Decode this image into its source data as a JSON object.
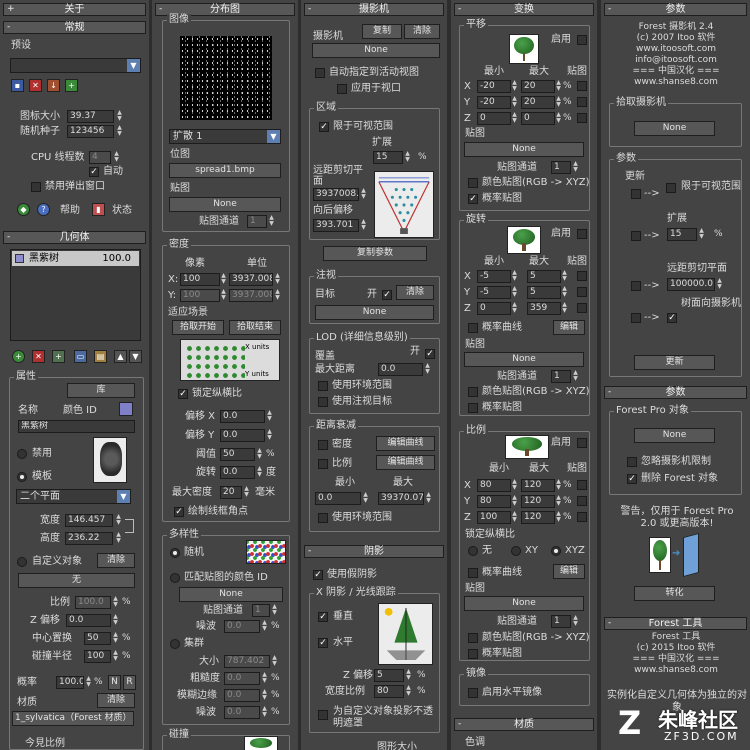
{
  "c1": {
    "about": "关于",
    "general": "常规",
    "preset": "预设",
    "icon_size": "图标大小",
    "icon_size_v": "39.37",
    "seed": "随机种子",
    "seed_v": "123456",
    "cpu": "CPU 线程数",
    "cpu_v": "4",
    "auto": "自动",
    "disable_popup": "禁用弹出窗口",
    "help": "帮助",
    "status": "状态",
    "geometry": "几何体",
    "geo_item": "黑紫树",
    "geo_item_v": "100.0",
    "props": "属性",
    "lib": "库",
    "name": "名称",
    "color_id": "颜色 ID",
    "name_v": "黑紫树",
    "disable": "禁用",
    "template": "模板",
    "plane": "二个平面",
    "width": "宽度",
    "width_v": "146.457",
    "height": "高度",
    "height_v": "236.22",
    "custom_obj": "自定义对象",
    "clear": "清除",
    "none_btn": "无",
    "scale": "比例",
    "scale_v": "100.0",
    "zoff": "Z 偏移",
    "zoff_v": "0.0",
    "center_disp": "中心置换",
    "center_disp_v": "50",
    "collision": "碰撞半径",
    "collision_v": "100",
    "prob": "概率",
    "prob_v": "100.0",
    "n": "N",
    "r": "R",
    "material": "材质",
    "mat_clear": "清除",
    "mat_v": "1_sylvatica（Forest 材质）",
    "bottom": "今見比例"
  },
  "c2": {
    "dist": "分布图",
    "image": "图像",
    "spread": "扩散 1",
    "bitmap": "位图",
    "bitmap_v": "spread1.bmp",
    "map": "贴图",
    "none": "None",
    "map_ch": "贴图通道",
    "map_ch_v": "1",
    "density": "密度",
    "pixels": "像素",
    "units": "单位",
    "x_px": "100",
    "x_un": "3937.008",
    "y_px": "100",
    "y_un": "3937.008",
    "fit": "适应场景",
    "pick_start": "拾取开始",
    "pick_end": "拾取结束",
    "x_units": "X units",
    "y_units": "Y units",
    "lock": "锁定纵横比",
    "offx": "偏移 X",
    "offx_v": "0.0",
    "offy": "偏移 Y",
    "offy_v": "0.0",
    "threshold": "阈值",
    "threshold_v": "50",
    "rotation": "旋转",
    "rotation_v": "0.0",
    "deg": "度",
    "maxdens": "最大密度",
    "maxdens_v": "20",
    "mm": "毫米",
    "draw_bbox": "绘制线框角点",
    "diversity": "多样性",
    "random": "随机",
    "match_color": "匹配贴图的颜色 ID",
    "none2": "None",
    "map_ch2": "贴图通道",
    "map_ch2_v": "1",
    "noise": "噪波",
    "noise_v": "0.0",
    "cluster": "集群",
    "size": "大小",
    "size_v": "787.402",
    "roughness": "粗糙度",
    "roughness_v": "0.0",
    "blur_edge": "模糊边缘",
    "blur_edge_v": "0.0",
    "noise2": "噪波",
    "noise2_v": "0.0",
    "collision": "碰撞"
  },
  "c3": {
    "camera": "摄影机",
    "cam_lbl": "摄影机",
    "copy": "复制",
    "clear": "清除",
    "none": "None",
    "auto_assign": "自动指定到活动视图",
    "apply_viewport": "应用于视口",
    "area": "区域",
    "limit_visible": "限于可视范围",
    "expand": "扩展",
    "expand_v": "15",
    "far_clip": "远距剪切平面",
    "far_clip_v": "3937008.",
    "back_offset": "向后偏移",
    "back_offset_v": "393.701",
    "copy_params": "复制参数",
    "target_grp": "注视",
    "target": "目标",
    "on": "开",
    "clear2": "清除",
    "none2": "None",
    "lod": "LOD (详细信息级别)",
    "cover": "覆盖",
    "cover_on": "开",
    "max_dist": "最大距离",
    "max_dist_v": "0.0",
    "use_env": "使用环境范围",
    "use_target": "使用注视目标",
    "falloff": "距离衰减",
    "density": "密度",
    "edit_curve": "编辑曲线",
    "scale": "比例",
    "edit_curve2": "编辑曲线",
    "min": "最小",
    "max": "最大",
    "min_v": "0.0",
    "max_v": "39370.07",
    "use_env2": "使用环境范围",
    "shadow": "阴影",
    "use_fake": "使用假阴影",
    "xshadow": "X 阴影 / 光线跟踪",
    "vertical": "垂直",
    "horizontal": "水平",
    "zoff": "Z 偏移",
    "zoff_v": "5",
    "wscale": "宽度比例",
    "wscale_v": "80",
    "custom_shadow": "为自定义对象投影不透明遮罩",
    "bottom": "图形大小"
  },
  "c4": {
    "transform": "变换",
    "translate": "平移",
    "enable": "启用",
    "min": "最小",
    "max": "最大",
    "map": "贴图",
    "tx_min": "-20",
    "tx_max": "20",
    "ty_min": "-20",
    "ty_max": "20",
    "tz_min": "0",
    "tz_max": "0",
    "map_lbl": "贴图",
    "none": "None",
    "map_ch": "贴图通道",
    "map_ch_v": "1",
    "color_map": "颜色贴图(RGB -> XYZ)",
    "prob_map": "概率贴图",
    "rotate": "旋转",
    "enable2": "启用",
    "rx_min": "-5",
    "rx_max": "5",
    "ry_min": "-5",
    "ry_max": "5",
    "rz_min": "0",
    "rz_max": "359",
    "prob_curve": "概率曲线",
    "edit": "编辑",
    "map2": "贴图",
    "none2": "None",
    "map_ch2": "贴图通道",
    "map_ch2_v": "1",
    "color_map2": "颜色贴图(RGB -> XYZ)",
    "prob_map2": "概率贴图",
    "scale": "比例",
    "enable3": "启用",
    "sx_min": "80",
    "sx_max": "120",
    "sy_min": "80",
    "sy_max": "120",
    "sz_min": "100",
    "sz_max": "120",
    "lock_aspect": "锁定纵横比",
    "none_r": "无",
    "xy": "XY",
    "xyz": "XYZ",
    "prob_curve2": "概率曲线",
    "edit2": "编辑",
    "map3": "贴图",
    "none3": "None",
    "map_ch3": "贴图通道",
    "map_ch3_v": "1",
    "color_map3": "颜色贴图(RGB -> XYZ)",
    "prob_map3": "概率贴图",
    "mirror": "镜像",
    "mirror_h": "启用水平镜像",
    "material": "材质",
    "color_adj": "色调"
  },
  "c5": {
    "params": "参数",
    "l1": "Forest 摄影机 2.4",
    "l2": "(c) 2007 Itoo 软件",
    "l3": "www.itoosoft.com",
    "l4": "info@itoosoft.com",
    "l5": "=== 中国汉化 ===",
    "l6": "www.shanse8.com",
    "pick_cam": "拾取摄影机",
    "none": "None",
    "params2": "参数",
    "update": "更新",
    "limit_vis": "限于可视范围",
    "expand": "扩展",
    "expand_v": "15",
    "far_clip": "远距剪切平面",
    "far_clip_v": "100000.0",
    "tree_face": "树面向摄影机",
    "update_btn": "更新",
    "params3": "参数",
    "fpro": "Forest Pro 对象",
    "none2": "None",
    "ignore_cam": "忽略摄影机限制",
    "del_forest": "删除 Forest 对象",
    "warn": "警告，仅用于 Forest Pro 2.0 或更高版本!",
    "convert": "转化",
    "ftools": "Forest 工具",
    "t1": "Forest 工具",
    "t2": "(c) 2015 Itoo 软件",
    "t3": "=== 中国汉化 ===",
    "t4": "www.shanse8.com",
    "instance": "实例化自定义几何体为独立的对象",
    "watermark": "朱峰社区",
    "watermark_url": "ZF3D.COM"
  }
}
